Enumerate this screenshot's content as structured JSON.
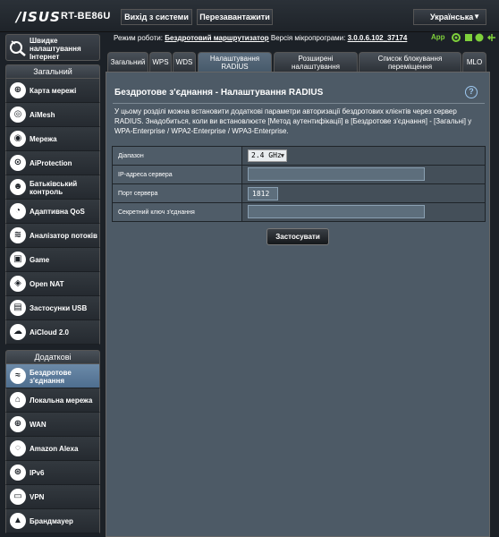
{
  "header": {
    "logo": "/ISUS",
    "model": "RT-BE86U",
    "logout_label": "Вихід з системи",
    "reboot_label": "Перезавантажити",
    "language": "Українська"
  },
  "status": {
    "mode_label": "Режим роботи:",
    "mode_value": "Бездротовий маршрутизатор",
    "fw_label": "Версія мікропрограми:",
    "fw_value": "3.0.0.6.102_37174",
    "app_label": "App"
  },
  "sidebar": {
    "qis_label": "Швидке налаштування Інтернет",
    "general_header": "Загальний",
    "general_items": [
      {
        "label": "Карта мережі",
        "icon": "network-map-icon",
        "glyph": "⊕"
      },
      {
        "label": "AiMesh",
        "icon": "aimesh-icon",
        "glyph": "◎"
      },
      {
        "label": "Мережа",
        "icon": "guest-network-icon",
        "glyph": "◉"
      },
      {
        "label": "AiProtection",
        "icon": "aiprotection-icon",
        "glyph": "⊙"
      },
      {
        "label": "Батьківський контроль",
        "icon": "parental-control-icon",
        "glyph": "☻"
      },
      {
        "label": "Адаптивна QoS",
        "icon": "qos-icon",
        "glyph": "◔"
      },
      {
        "label": "Аналізатор потоків",
        "icon": "traffic-analyzer-icon",
        "glyph": "≋"
      },
      {
        "label": "Game",
        "icon": "game-icon",
        "glyph": "▣"
      },
      {
        "label": "Open NAT",
        "icon": "open-nat-icon",
        "glyph": "◈"
      },
      {
        "label": "Застосунки USB",
        "icon": "usb-icon",
        "glyph": "▤"
      },
      {
        "label": "AiCloud 2.0",
        "icon": "aicloud-icon",
        "glyph": "☁"
      }
    ],
    "advanced_header": "Додаткові налаштування",
    "advanced_items": [
      {
        "label": "Бездротове з'єднання",
        "icon": "wireless-icon",
        "glyph": "≈",
        "active": true
      },
      {
        "label": "Локальна мережа",
        "icon": "lan-icon",
        "glyph": "⌂",
        "active": false
      },
      {
        "label": "WAN",
        "icon": "wan-icon",
        "glyph": "⊕",
        "active": false
      },
      {
        "label": "Amazon Alexa",
        "icon": "alexa-icon",
        "glyph": "◌",
        "active": false
      },
      {
        "label": "IPv6",
        "icon": "ipv6-icon",
        "glyph": "⊛",
        "active": false
      },
      {
        "label": "VPN",
        "icon": "vpn-icon",
        "glyph": "▭",
        "active": false
      },
      {
        "label": "Брандмауер",
        "icon": "firewall-icon",
        "glyph": "▲",
        "active": false
      }
    ]
  },
  "tabs": [
    {
      "label": "Загальний",
      "active": false
    },
    {
      "label": "WPS",
      "active": false
    },
    {
      "label": "WDS",
      "active": false
    },
    {
      "label": "Налаштування RADIUS",
      "active": true
    },
    {
      "label": "Розширені налаштування",
      "active": false
    },
    {
      "label": "Список блокування переміщення",
      "active": false
    },
    {
      "label": "MLO",
      "active": false
    }
  ],
  "main": {
    "title": "Бездротове з'єднання - Налаштування RADIUS",
    "description": "У цьому розділі можна встановити додаткові параметри авторизації бездротових клієнтів через сервер RADIUS. Знадобиться, коли ви встановлюєте [Метод аутентифікації] в [Бездротове з'єднання] - [Загальні] у WPA-Enterprise / WPA2-Enterprise / WPA3-Enterprise.",
    "fields": {
      "band_label": "Діапазон",
      "band_value": "2.4 GHz",
      "server_ip_label": "IP-адреса сервера",
      "server_ip_value": "",
      "server_port_label": "Порт сервера",
      "server_port_value": "1812",
      "secret_label": "Секретний ключ з'єднання",
      "secret_value": ""
    },
    "apply_label": "Застосувати"
  },
  "colors": {
    "background": "#1c2127",
    "panel": "#4d5a66",
    "active_menu": "#5b7a99",
    "app_accent": "#7fd13b"
  }
}
